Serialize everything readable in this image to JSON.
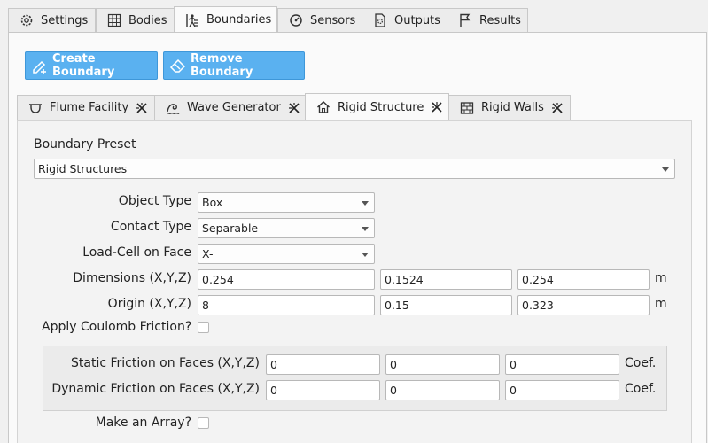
{
  "tabs": [
    {
      "label": "Settings",
      "icon": "gear-icon"
    },
    {
      "label": "Bodies",
      "icon": "grid-icon"
    },
    {
      "label": "Boundaries",
      "icon": "boundary-figure-icon",
      "active": true
    },
    {
      "label": "Sensors",
      "icon": "gauge-icon"
    },
    {
      "label": "Outputs",
      "icon": "file-gear-icon"
    },
    {
      "label": "Results",
      "icon": "flag-icon"
    }
  ],
  "toolbar": {
    "create_label": "Create Boundary",
    "remove_label": "Remove Boundary",
    "accent": "#5ab1f0"
  },
  "subtabs": [
    {
      "label": "Flume Facility",
      "icon": "flume-icon"
    },
    {
      "label": "Wave Generator",
      "icon": "wave-generator-icon"
    },
    {
      "label": "Rigid Structure",
      "icon": "house-icon",
      "active": true
    },
    {
      "label": "Rigid Walls",
      "icon": "wall-icon"
    }
  ],
  "preset": {
    "label": "Boundary Preset",
    "value": "Rigid Structures"
  },
  "form": {
    "object_type_label": "Object Type",
    "object_type_value": "Box",
    "contact_type_label": "Contact Type",
    "contact_type_value": "Separable",
    "load_cell_label": "Load-Cell on Face",
    "load_cell_value": "X-",
    "dimensions_label": "Dimensions (X,Y,Z)",
    "dimensions": [
      "0.254",
      "0.1524",
      "0.254"
    ],
    "dimensions_unit": "m",
    "origin_label": "Origin (X,Y,Z)",
    "origin": [
      "8",
      "0.15",
      "0.323"
    ],
    "origin_unit": "m",
    "coulomb_label": "Apply Coulomb Friction?",
    "static_label": "Static Friction on Faces (X,Y,Z)",
    "static": [
      "0",
      "0",
      "0"
    ],
    "static_unit": "Coef.",
    "dynamic_label": "Dynamic Friction on Faces (X,Y,Z)",
    "dynamic": [
      "0",
      "0",
      "0"
    ],
    "dynamic_unit": "Coef.",
    "array_label": "Make an Array?"
  }
}
